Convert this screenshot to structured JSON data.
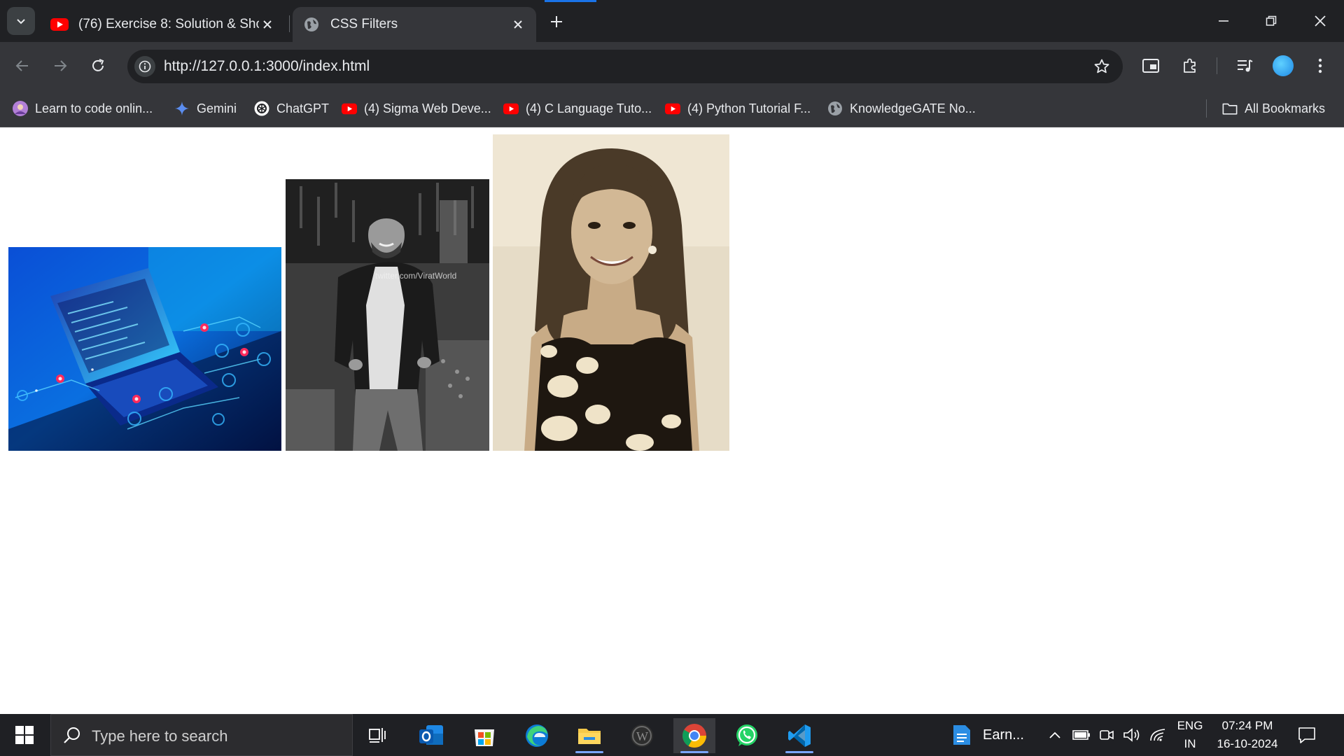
{
  "browser": {
    "tabs": [
      {
        "title": "(76) Exercise 8: Solution & Shoutouts",
        "active": false,
        "favicon": "youtube-icon"
      },
      {
        "title": "CSS Filters",
        "active": true,
        "favicon": "globe-icon"
      }
    ],
    "url": "http://127.0.0.1:3000/index.html",
    "bookmarks": [
      {
        "label": "Learn to code onlin...",
        "icon": "avatar-icon"
      },
      {
        "label": "Gemini",
        "icon": "gemini-sparkle-icon"
      },
      {
        "label": "ChatGPT",
        "icon": "chatgpt-icon"
      },
      {
        "label": "(4) Sigma Web Deve...",
        "icon": "youtube-icon"
      },
      {
        "label": "(4) C Language Tuto...",
        "icon": "youtube-icon"
      },
      {
        "label": "(4) Python Tutorial F...",
        "icon": "youtube-icon"
      },
      {
        "label": "KnowledgeGATE No...",
        "icon": "globe-icon"
      }
    ],
    "all_bookmarks": "All Bookmarks"
  },
  "page": {
    "images": [
      {
        "description_icon": "laptop-circuit-image",
        "filter": "none"
      },
      {
        "description_icon": "man-portrait-image",
        "filter": "grayscale"
      },
      {
        "description_icon": "woman-portrait-image",
        "filter": "sepia"
      }
    ],
    "watermark": "twitter.com/ViratWorld"
  },
  "taskbar": {
    "search_placeholder": "Type here to search",
    "running_app_label": "Earn...",
    "language_top": "ENG",
    "language_bottom": "IN",
    "time": "07:24 PM",
    "date": "16-10-2024"
  },
  "colors": {
    "titlebar": "#202124",
    "toolbar": "#35363a",
    "taskbar": "#1f2024",
    "accent": "#1a73e8"
  }
}
